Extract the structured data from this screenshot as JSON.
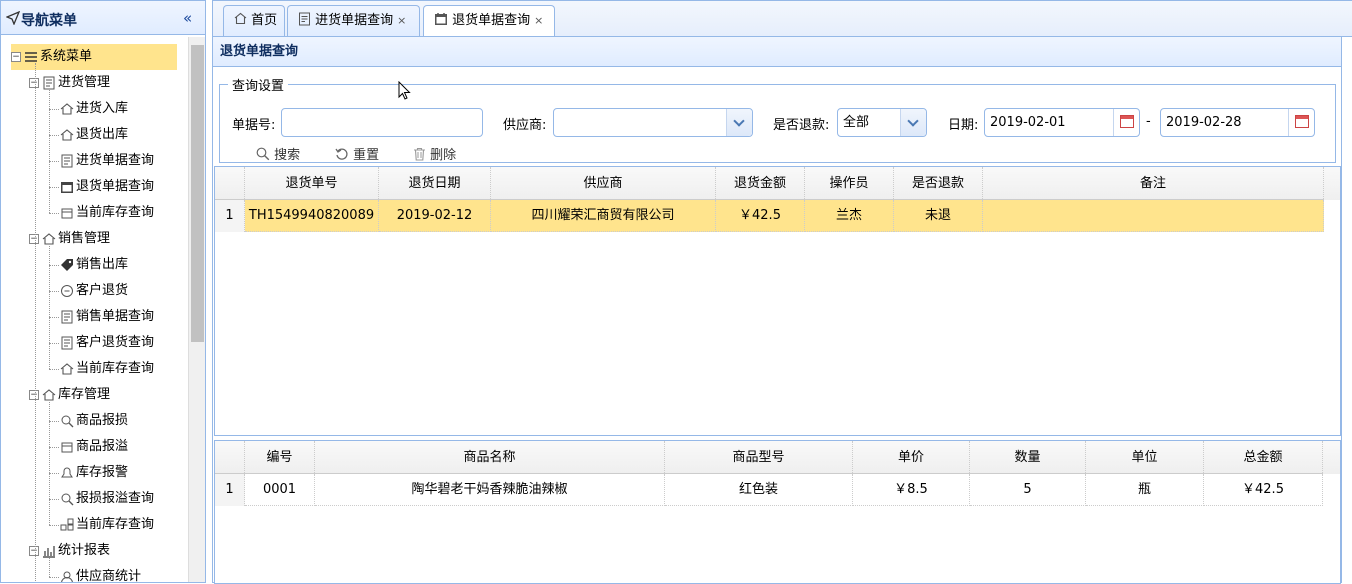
{
  "nav": {
    "title": "导航菜单",
    "collapse_glyph": "«",
    "root": "系统菜单",
    "groups": [
      {
        "label": "进货管理",
        "items": [
          "进货入库",
          "退货出库",
          "进货单据查询",
          "退货单据查询",
          "当前库存查询"
        ]
      },
      {
        "label": "销售管理",
        "items": [
          "销售出库",
          "客户退货",
          "销售单据查询",
          "客户退货查询",
          "当前库存查询"
        ]
      },
      {
        "label": "库存管理",
        "items": [
          "商品报损",
          "商品报溢",
          "库存报警",
          "报损报溢查询",
          "当前库存查询"
        ]
      },
      {
        "label": "统计报表",
        "items": [
          "供应商统计"
        ]
      }
    ]
  },
  "tabs": [
    {
      "label": "首页",
      "closable": false
    },
    {
      "label": "进货单据查询",
      "closable": true
    },
    {
      "label": "退货单据查询",
      "closable": true,
      "active": true
    }
  ],
  "tab_close_glyph": "×",
  "panel": {
    "title": "退货单据查询"
  },
  "query": {
    "legend": "查询设置",
    "bill_no_label": "单据号:",
    "bill_no_value": "",
    "supplier_label": "供应商:",
    "supplier_value": "",
    "refund_label": "是否退款:",
    "refund_value": "全部",
    "date_label": "日期:",
    "date_from": "2019-02-01",
    "date_sep": "-",
    "date_to": "2019-02-28",
    "search_label": "搜索",
    "reset_label": "重置",
    "delete_label": "删除"
  },
  "bills": {
    "columns": [
      "退货单号",
      "退货日期",
      "供应商",
      "退货金额",
      "操作员",
      "是否退款",
      "备注"
    ],
    "rows": [
      {
        "num": "1",
        "cells": [
          "TH1549940820089",
          "2019-02-12",
          "四川耀荣汇商贸有限公司",
          "￥42.5",
          "兰杰",
          "未退",
          ""
        ]
      }
    ]
  },
  "items": {
    "columns": [
      "编号",
      "商品名称",
      "商品型号",
      "单价",
      "数量",
      "单位",
      "总金额"
    ],
    "rows": [
      {
        "num": "1",
        "cells": [
          "0001",
          "陶华碧老干妈香辣脆油辣椒",
          "红色装",
          "￥8.5",
          "5",
          "瓶",
          "￥42.5"
        ]
      }
    ]
  },
  "colors": {
    "border": "#95b8e7",
    "selected": "#ffe48d",
    "header_text": "#0e2d5f"
  }
}
